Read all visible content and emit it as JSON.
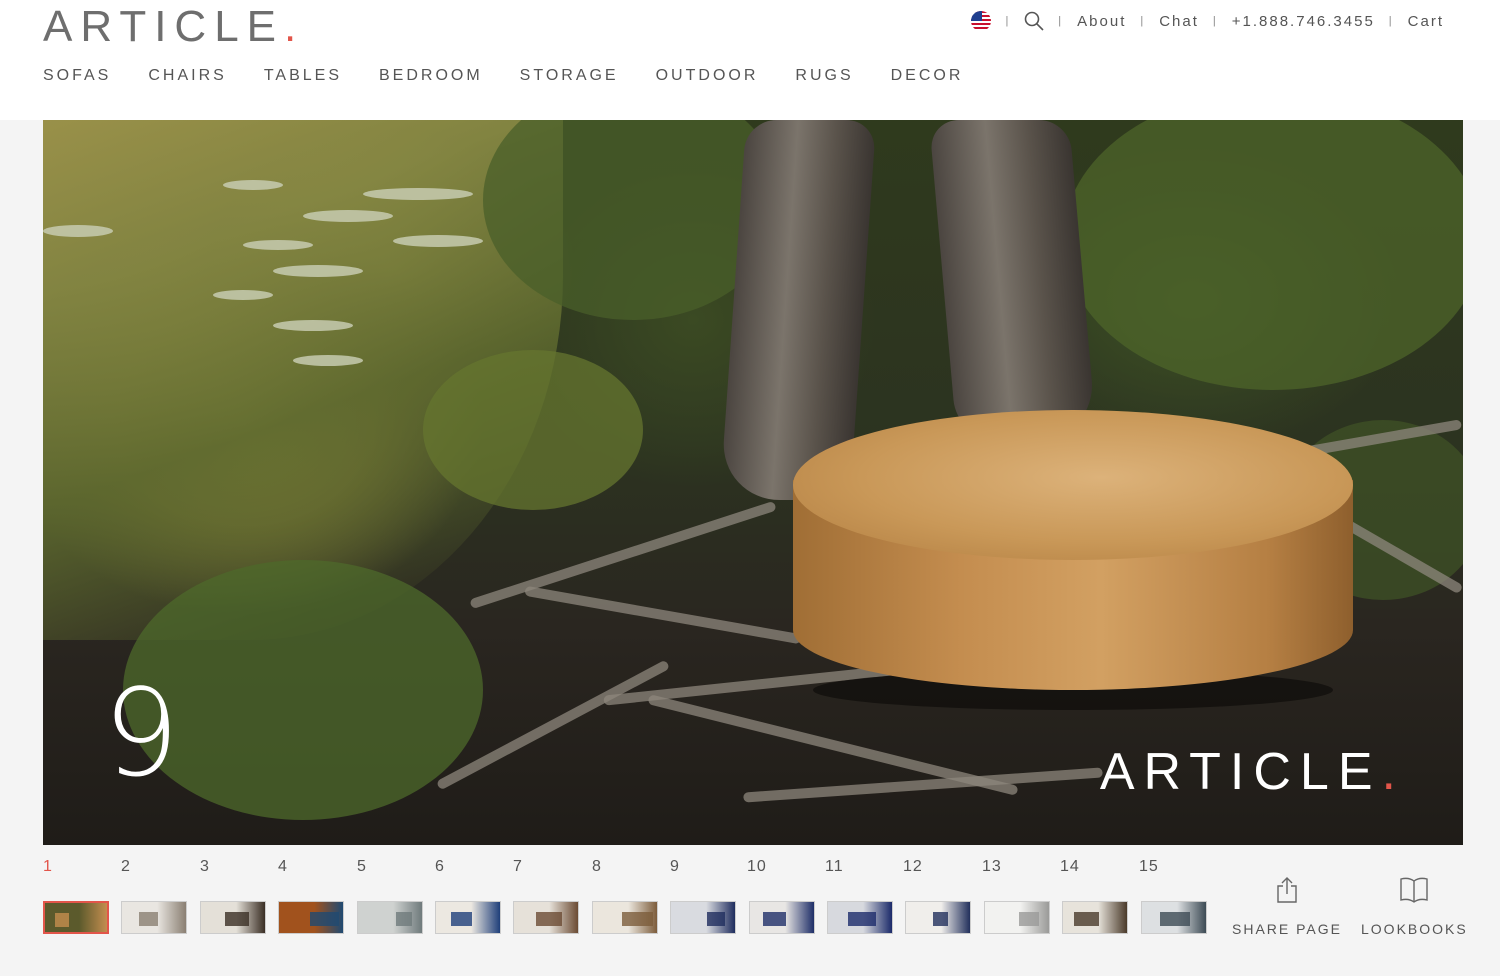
{
  "brand": {
    "logo_text": "ARTICLE",
    "logo_dot": ".",
    "accent": "#e2554a"
  },
  "utility": {
    "flag_icon": "us-flag-icon",
    "search_icon": "search-icon",
    "about": "About",
    "chat": "Chat",
    "phone": "+1.888.746.3455",
    "cart": "Cart",
    "separator": "|"
  },
  "nav": [
    "SOFAS",
    "CHAIRS",
    "TABLES",
    "BEDROOM",
    "STORAGE",
    "OUTDOOR",
    "RUGS",
    "DECOR"
  ],
  "hero": {
    "page_number": "9",
    "logo_text": "ARTICLE",
    "logo_dot": "."
  },
  "pages": {
    "active": "1",
    "numbers": [
      "1",
      "2",
      "3",
      "4",
      "5",
      "6",
      "7",
      "8",
      "9",
      "10",
      "11",
      "12",
      "13",
      "14",
      "15"
    ]
  },
  "actions": {
    "share_label": "SHARE PAGE",
    "share_icon": "share-icon",
    "lookbooks_label": "LOOKBOOKS",
    "lookbooks_icon": "book-icon"
  }
}
